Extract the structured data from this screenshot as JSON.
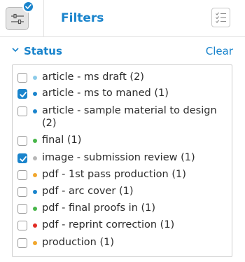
{
  "header": {
    "title": "Filters",
    "filter_button_icon": "sliders-icon",
    "badge_icon": "checkmark-icon",
    "list_button_icon": "checklist-icon"
  },
  "section": {
    "title": "Status",
    "clear_label": "Clear",
    "collapse_icon": "chevron-down-icon"
  },
  "colors": {
    "accent": "#1a84cc",
    "light_blue": "#8ccbe9",
    "blue": "#1a84cc",
    "green": "#47b649",
    "gray": "#b7b7b7",
    "orange": "#f1a72e",
    "red": "#e12b24"
  },
  "items": [
    {
      "label": "article - ms draft (2)",
      "checked": false,
      "color": "#8ccbe9"
    },
    {
      "label": "article - ms to maned (1)",
      "checked": true,
      "color": "#1a84cc"
    },
    {
      "label": "article - sample material to design (2)",
      "checked": false,
      "color": "#1a84cc"
    },
    {
      "label": "final (1)",
      "checked": false,
      "color": "#47b649"
    },
    {
      "label": "image - submission review (1)",
      "checked": true,
      "color": "#b7b7b7"
    },
    {
      "label": "pdf - 1st pass production (1)",
      "checked": false,
      "color": "#f1a72e"
    },
    {
      "label": "pdf - arc cover (1)",
      "checked": false,
      "color": "#1a84cc"
    },
    {
      "label": "pdf - final proofs in (1)",
      "checked": false,
      "color": "#47b649"
    },
    {
      "label": "pdf - reprint correction (1)",
      "checked": false,
      "color": "#e12b24"
    },
    {
      "label": "production (1)",
      "checked": false,
      "color": "#f1a72e"
    }
  ]
}
